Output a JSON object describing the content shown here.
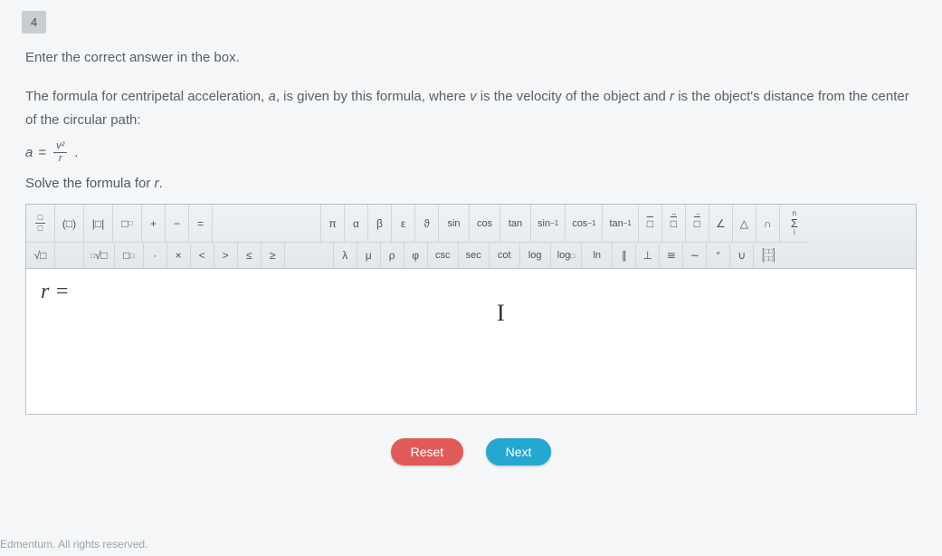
{
  "question_number": "4",
  "instruction": "Enter the correct answer in the box.",
  "prompt_pt1": "The formula for centripetal acceleration, ",
  "prompt_var_a": "a",
  "prompt_pt2": ", is given by this formula, where ",
  "prompt_var_v": "v",
  "prompt_pt3": " is the velocity of the object and ",
  "prompt_var_r": "r",
  "prompt_pt4": " is the object's distance from the center of the circular path:",
  "formula_lhs": "a",
  "formula_eq": "=",
  "formula_num": "v²",
  "formula_den": "r",
  "formula_period": ".",
  "solve_line_pt1": "Solve the formula for ",
  "solve_var_r": "r",
  "solve_line_pt2": ".",
  "answer_prefix": "r =",
  "cursor_mark": "I",
  "buttons": {
    "reset": "Reset",
    "next": "Next"
  },
  "footer": "Edmentum. All rights reserved.",
  "toolbar": {
    "row1": {
      "frac_num": "□",
      "frac_den": "□",
      "paren": "(□)",
      "abs": "|□|",
      "exp": "□",
      "exp_sup": "□",
      "plus": "+",
      "minus": "−",
      "eq": "=",
      "pi": "π",
      "alpha": "α",
      "beta": "β",
      "epsilon": "ε",
      "vartheta": "ϑ",
      "sin": "sin",
      "cos": "cos",
      "tan": "tan",
      "asin": "sin",
      "asin_sup": "−1",
      "acos": "cos",
      "acos_sup": "−1",
      "atan": "tan",
      "atan_sup": "−1",
      "bar": "□",
      "harr": "↔",
      "rarr": "→",
      "angle": "∠",
      "tri": "△",
      "cap": "∩",
      "sum": "Σ",
      "sum_top": "n",
      "sum_bot": "i"
    },
    "row2": {
      "sqrt": "√□",
      "nroot": "□√□",
      "nroot_n": "□",
      "sub": "□",
      "sub_sub": "□",
      "dot": "·",
      "times": "×",
      "lt": "<",
      "gt": ">",
      "le": "≤",
      "ge": "≥",
      "lambda": "λ",
      "mu": "μ",
      "rho": "ρ",
      "phi": "φ",
      "csc": "csc",
      "sec": "sec",
      "cot": "cot",
      "log": "log",
      "logn": "log",
      "logn_sub": "□",
      "ln": "ln",
      "parallel": "∥",
      "perp": "⊥",
      "cong": "≅",
      "sim": "∼",
      "degree": "°",
      "union": "∪",
      "matrix": "□□",
      "matrix2": "□□"
    }
  }
}
